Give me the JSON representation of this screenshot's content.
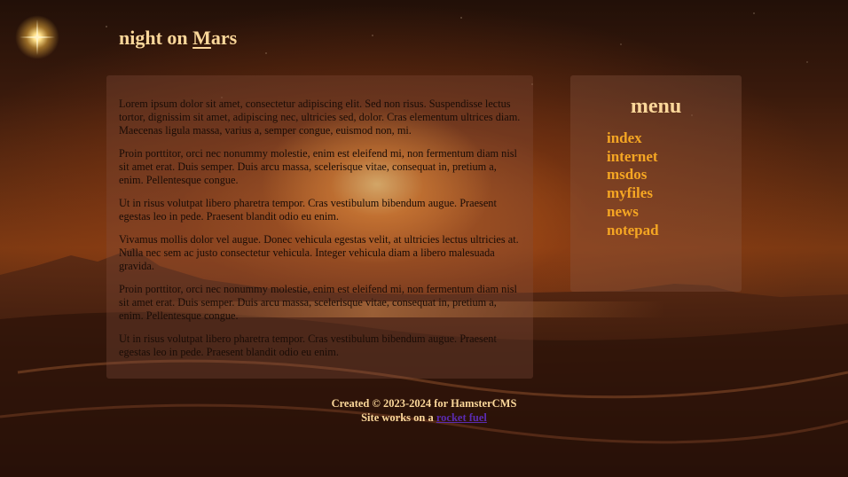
{
  "header": {
    "title_initial_before": "night on ",
    "title_underlined": "M",
    "title_after": "ars"
  },
  "content": {
    "paragraphs": [
      "Lorem ipsum dolor sit amet, consectetur adipiscing elit. Sed non risus. Suspendisse lectus tortor, dignissim sit amet, adipiscing nec, ultricies sed, dolor. Cras elementum ultrices diam. Maecenas ligula massa, varius a, semper congue, euismod non, mi.",
      "Proin porttitor, orci nec nonummy molestie, enim est eleifend mi, non fermentum diam nisl sit amet erat. Duis semper. Duis arcu massa, scelerisque vitae, consequat in, pretium a, enim. Pellentesque congue.",
      "Ut in risus volutpat libero pharetra tempor. Cras vestibulum bibendum augue. Praesent egestas leo in pede. Praesent blandit odio eu enim.",
      "Vivamus mollis dolor vel augue. Donec vehicula egestas velit, at ultricies lectus ultricies at. Nulla nec sem ac justo consectetur vehicula. Integer vehicula diam a libero malesuada gravida.",
      "Proin porttitor, orci nec nonummy molestie, enim est eleifend mi, non fermentum diam nisl sit amet erat. Duis semper. Duis arcu massa, scelerisque vitae, consequat in, pretium a, enim. Pellentesque congue.",
      "Ut in risus volutpat libero pharetra tempor. Cras vestibulum bibendum augue. Praesent egestas leo in pede. Praesent blandit odio eu enim."
    ]
  },
  "menu": {
    "heading": "menu",
    "items": [
      {
        "label": "index"
      },
      {
        "label": "internet"
      },
      {
        "label": "msdos"
      },
      {
        "label": "myfiles"
      },
      {
        "label": "news"
      },
      {
        "label": "notepad"
      }
    ]
  },
  "footer": {
    "line1": "Created © 2023-2024 for HamsterCMS",
    "line2_prefix": "Site works on a ",
    "link_text": "rocket fuel"
  },
  "icons": {
    "logo": "sun-star-icon"
  },
  "colors": {
    "title": "#fbd79a",
    "menu_link": "#f5a623",
    "footer_link": "#5a2bb0"
  }
}
